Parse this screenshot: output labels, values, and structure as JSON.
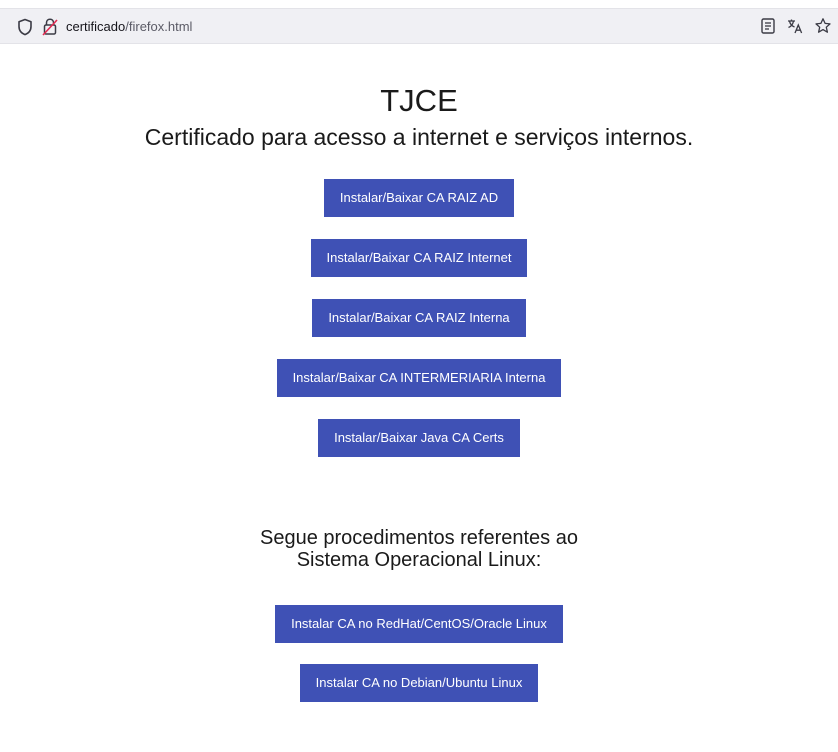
{
  "browser": {
    "url_host": "certificado",
    "url_path": "/firefox.html",
    "icons": [
      "shield-icon",
      "insecure-lock-icon",
      "reader-view-icon",
      "translate-icon",
      "bookmark-star-icon"
    ]
  },
  "page": {
    "title": "TJCE",
    "subtitle": "Certificado para acesso a internet e serviços internos.",
    "cert_buttons": [
      "Instalar/Baixar CA RAIZ AD",
      "Instalar/Baixar CA RAIZ Internet",
      "Instalar/Baixar CA RAIZ Interna",
      "Instalar/Baixar CA INTERMERIARIA Interna",
      "Instalar/Baixar Java CA Certs"
    ],
    "linux_heading_line1": "Segue procedimentos referentes ao",
    "linux_heading_line2": "Sistema Operacional Linux:",
    "linux_buttons": [
      "Instalar CA no RedHat/CentOS/Oracle Linux",
      "Instalar CA no Debian/Ubuntu Linux"
    ]
  },
  "colors": {
    "button_bg": "#3f51b5",
    "button_text": "#ffffff",
    "urlbar_bg": "#f0f0f4"
  }
}
